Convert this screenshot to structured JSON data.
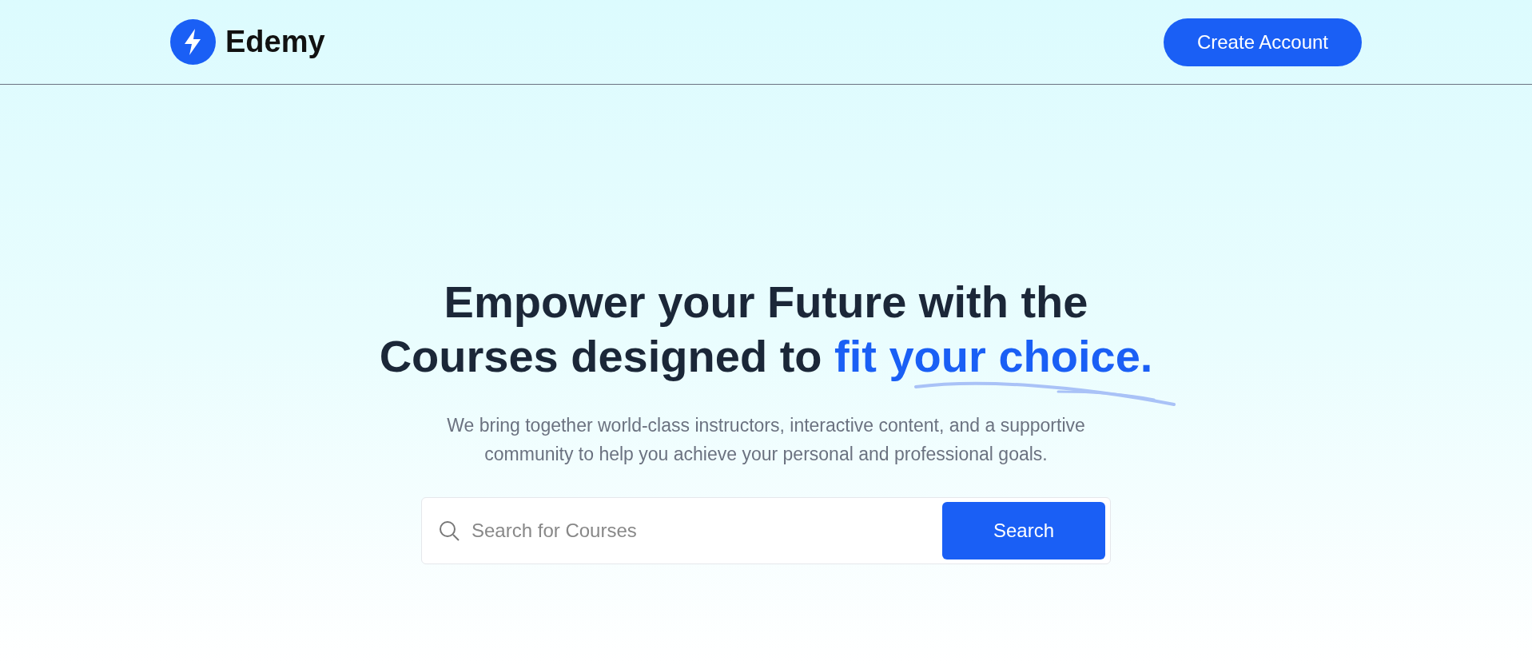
{
  "brand": {
    "name": "Edemy"
  },
  "header": {
    "button": "Create Account"
  },
  "hero": {
    "heading": "Empower your Future with the Courses designed to ",
    "highlight": "fit your choice.",
    "subtitle": "We bring together world-class instructors, interactive content, and a supportive community to help you achieve your personal and professional goals."
  },
  "search": {
    "placeholder": "Search for Courses",
    "button": "Search"
  }
}
